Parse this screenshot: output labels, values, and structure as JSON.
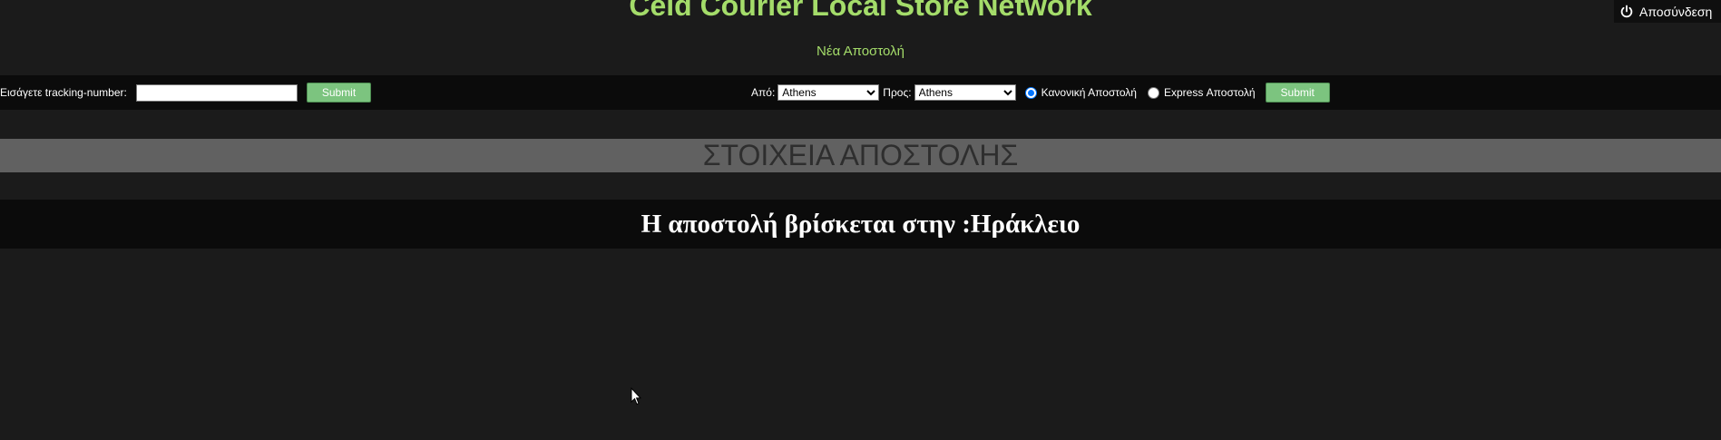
{
  "header": {
    "title": "Ceid Courier Local Store Network",
    "new_shipment_link": "Νέα Αποστολή",
    "logout_label": "Αποσύνδεση",
    "logout_icon": "power-icon"
  },
  "tracking": {
    "label": "Εισάγετε tracking-number:",
    "value": "",
    "submit_label": "Submit"
  },
  "shipment_form": {
    "from_label": "Από:",
    "from_value": "Athens",
    "to_label": "Προς:",
    "to_value": "Athens",
    "standard_label": "Κανονική Αποστολή",
    "standard_checked": true,
    "express_label": "Express Αποστολή",
    "express_checked": false,
    "submit_label": "Submit"
  },
  "section": {
    "heading": "ΣΤΟΙΧΕΙΑ ΑΠΟΣΤΟΛΗΣ"
  },
  "status": {
    "message": "Η αποστολή βρίσκεται στην :Ηράκλειο"
  },
  "colors": {
    "background": "#1b1b1b",
    "accent_green": "#a4dc6a",
    "button_green": "#7cc47f",
    "toolbar": "#0b0b0b",
    "banner": "#616161"
  }
}
